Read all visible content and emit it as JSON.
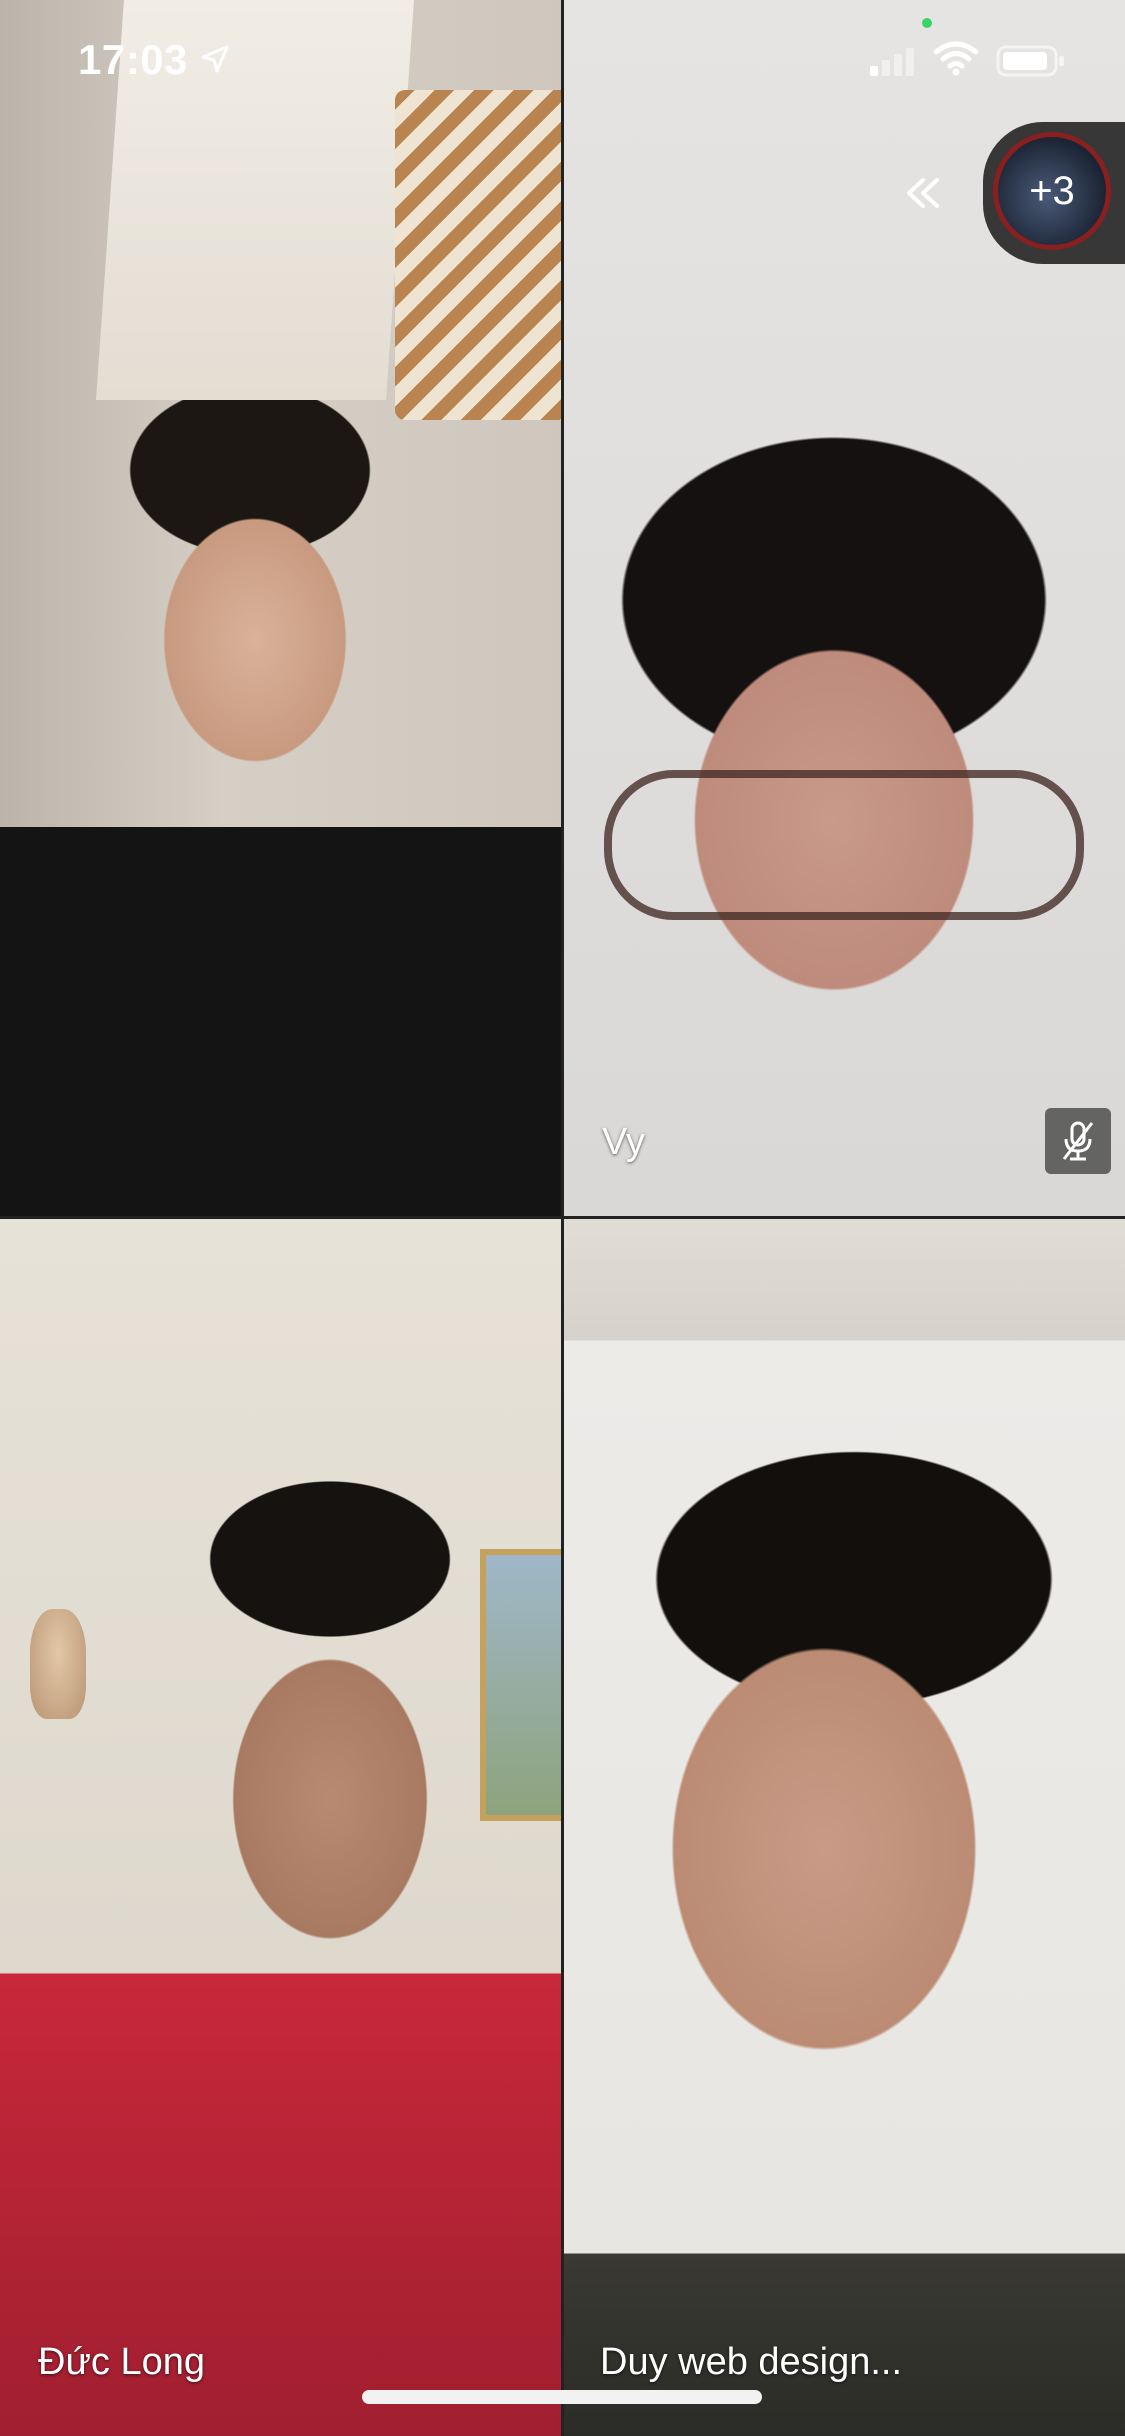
{
  "status_bar": {
    "time": "17:03"
  },
  "overlay": {
    "more_count": "+3"
  },
  "participants": [
    {
      "name": "",
      "muted": false
    },
    {
      "name": "Vy",
      "muted": true
    },
    {
      "name": "Đức Long",
      "muted": false
    },
    {
      "name": "Duy web design...",
      "muted": false
    }
  ],
  "icons": {
    "location": "location-arrow-icon",
    "signal": "cellular-signal-icon",
    "wifi": "wifi-icon",
    "battery": "battery-icon",
    "collapse": "double-chevron-left-icon",
    "mute": "microphone-muted-icon"
  },
  "colors": {
    "overlay_bg": "#282828",
    "avatar_ring": "#8a1f1f",
    "status_dot": "#3ad26b"
  }
}
